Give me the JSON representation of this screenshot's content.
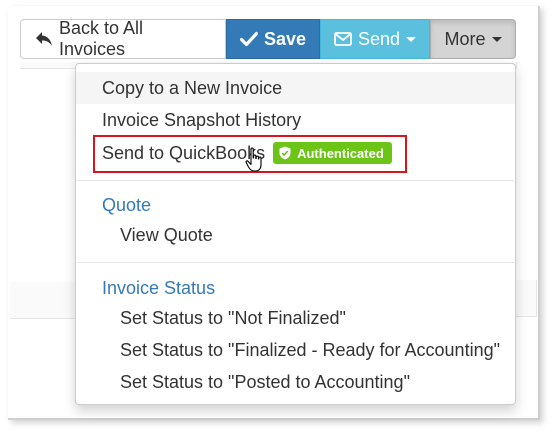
{
  "toolbar": {
    "back_label": "Back to All Invoices",
    "save_label": "Save",
    "send_label": "Send",
    "more_label": "More"
  },
  "menu": {
    "copy": "Copy to a New Invoice",
    "snapshot": "Invoice Snapshot History",
    "send_qb": "Send to QuickBooks",
    "badge": "Authenticated",
    "quote_header": "Quote",
    "view_quote": "View Quote",
    "status_header": "Invoice Status",
    "status_not_finalized": "Set Status to \"Not Finalized\"",
    "status_finalized": "Set Status to \"Finalized - Ready for Accounting\"",
    "status_posted": "Set Status to \"Posted to Accounting\""
  },
  "colors": {
    "primary": "#337ab7",
    "info": "#5bc0de",
    "success_badge": "#6bc416",
    "highlight_border": "#d8141c"
  }
}
